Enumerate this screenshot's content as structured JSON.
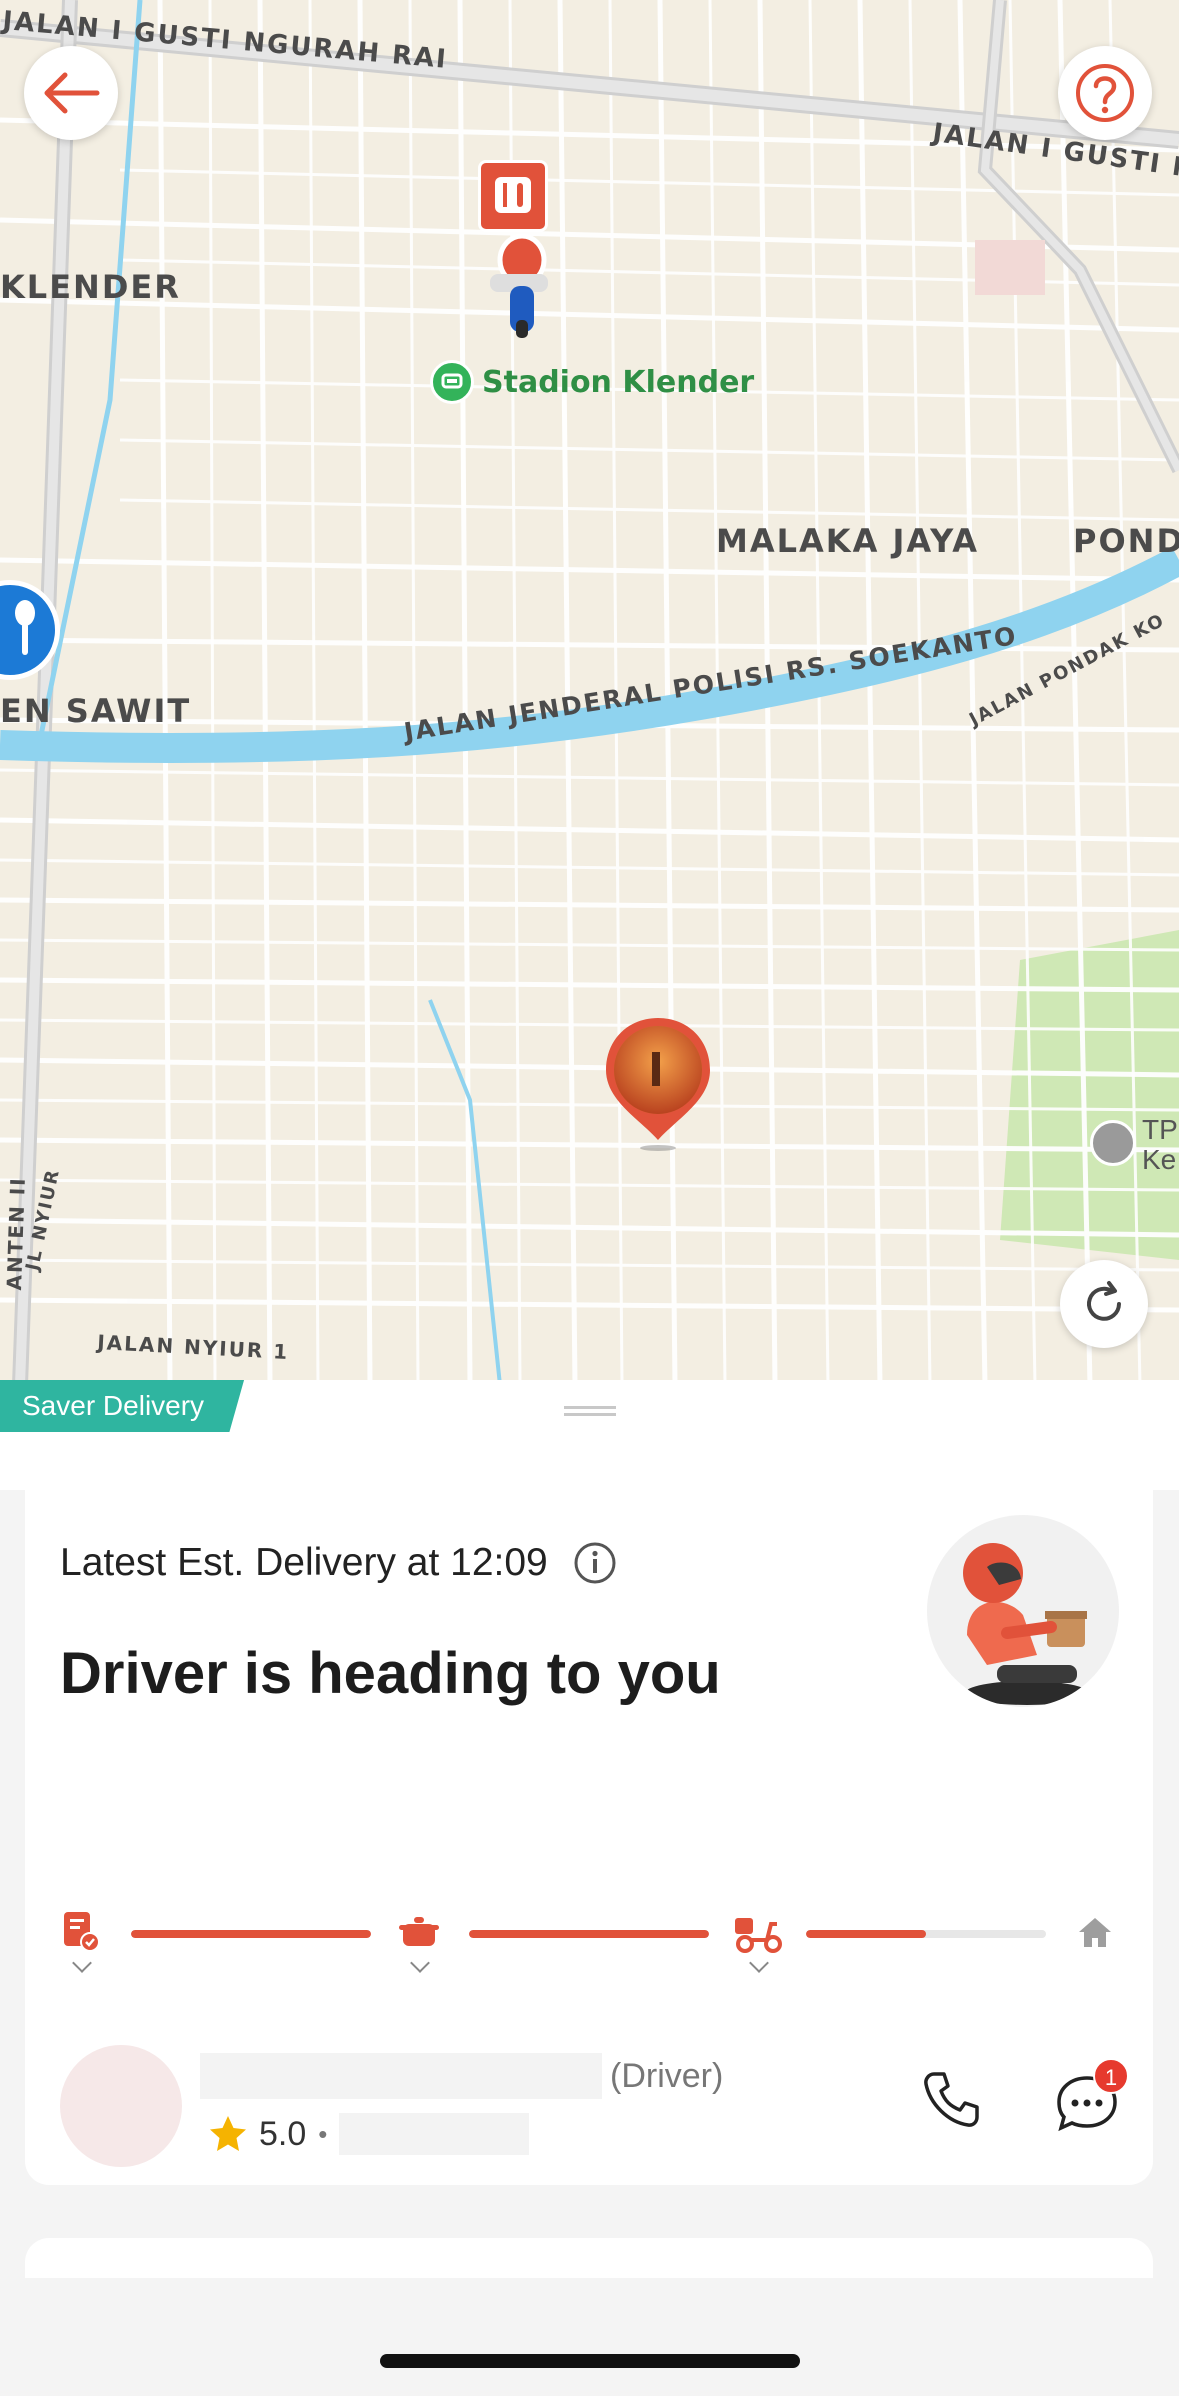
{
  "map": {
    "labels": {
      "road_top": "JALAN I GUSTI NGURAH RAI",
      "road_top_right": "JALAN I GUSTI N",
      "klender": "KLENDER",
      "stadium": "Stadion Klender",
      "malaka": "MALAKA JAYA",
      "pondok": "PONDO",
      "sawit": "EN SAWIT",
      "river_road": "JALAN JENDERAL POLISI RS. SOEKANTO",
      "pondok_road": "JALAN PONDAK KO",
      "nyiur": "JL NYIUR",
      "nyiur1": "JALAN NYIUR 1",
      "left_road": "ANTEN II",
      "tp_line1": "TP",
      "tp_line2": "Ke"
    }
  },
  "sheet": {
    "service_tag": "Saver Delivery",
    "eta_text": "Latest Est. Delivery at 12:09",
    "status_title": "Driver is heading to you",
    "progress": {
      "steps": [
        "order-confirmed",
        "food-ready",
        "on-the-way",
        "home"
      ],
      "segment_fill": [
        1,
        1,
        0.5
      ]
    },
    "driver": {
      "role_label": "(Driver)",
      "rating": "5.0",
      "separator": "•",
      "chat_badge": "1"
    }
  },
  "colors": {
    "accent": "#e1523a",
    "teal": "#2fb5a0",
    "river": "#8fd3ef",
    "park": "#cfe8b5"
  }
}
